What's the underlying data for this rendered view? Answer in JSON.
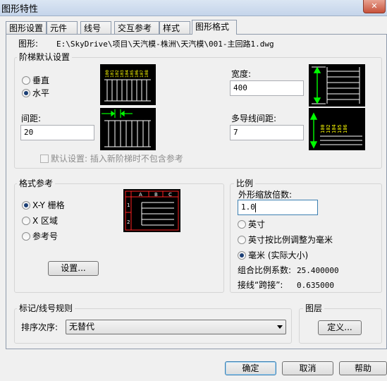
{
  "window": {
    "title": "图形特性",
    "close_glyph": "✕"
  },
  "tabs": [
    "图形设置",
    "元件",
    "线号",
    "交互参考",
    "样式",
    "图形格式"
  ],
  "drawing": {
    "label": "图形:",
    "path": "E:\\SkyDrive\\项目\\天汽模-株洲\\天汽模\\001-主回路1.dwg"
  },
  "ladder": {
    "title": "阶梯默认设置",
    "vertical": "垂直",
    "horizontal": "水平",
    "spacing_label": "间距:",
    "spacing_value": "20",
    "width_label": "宽度:",
    "width_value": "400",
    "multiwire_label": "多导线间距:",
    "multiwire_value": "7",
    "default_checkbox": "默认设置: 插入新阶梯时不包含参考",
    "preview_numbers": [
      "100",
      "101",
      "102",
      "103",
      "104",
      "105",
      "106",
      "107",
      "108"
    ],
    "preview_numbers_short": [
      "100",
      "102",
      "104",
      "105",
      "106"
    ]
  },
  "format_ref": {
    "title": "格式参考",
    "xy_grid": "X-Y 栅格",
    "x_zone": "X 区域",
    "ref_number": "参考号",
    "settings_button": "设置...",
    "grid_cols": [
      "A",
      "B",
      "C"
    ],
    "grid_rows": [
      "1",
      "2"
    ]
  },
  "scale": {
    "title": "比例",
    "feature_label": "外形缩放倍数:",
    "feature_value": "1.0",
    "inch": "英寸",
    "inch_to_mm": "英寸按比例调整为毫米",
    "mm": "毫米 (实际大小)",
    "lt_label": "组合比例系数:",
    "lt_value": "25.400000",
    "jumper_label": "接线“跨接”:",
    "jumper_value": "0.635000"
  },
  "tag_rules": {
    "title": "标记/线号规则",
    "sort_label": "排序次序:",
    "sort_value": "无替代"
  },
  "layers": {
    "title": "图层",
    "define_button": "定义..."
  },
  "footer": {
    "ok": "确定",
    "cancel": "取消",
    "help": "帮助"
  },
  "colors": {
    "preview_bg": "#000000",
    "ladder_line": "#ffffff",
    "number_text": "#ffff00",
    "arrow": "#00ff00",
    "grid_border": "#ff2222"
  }
}
